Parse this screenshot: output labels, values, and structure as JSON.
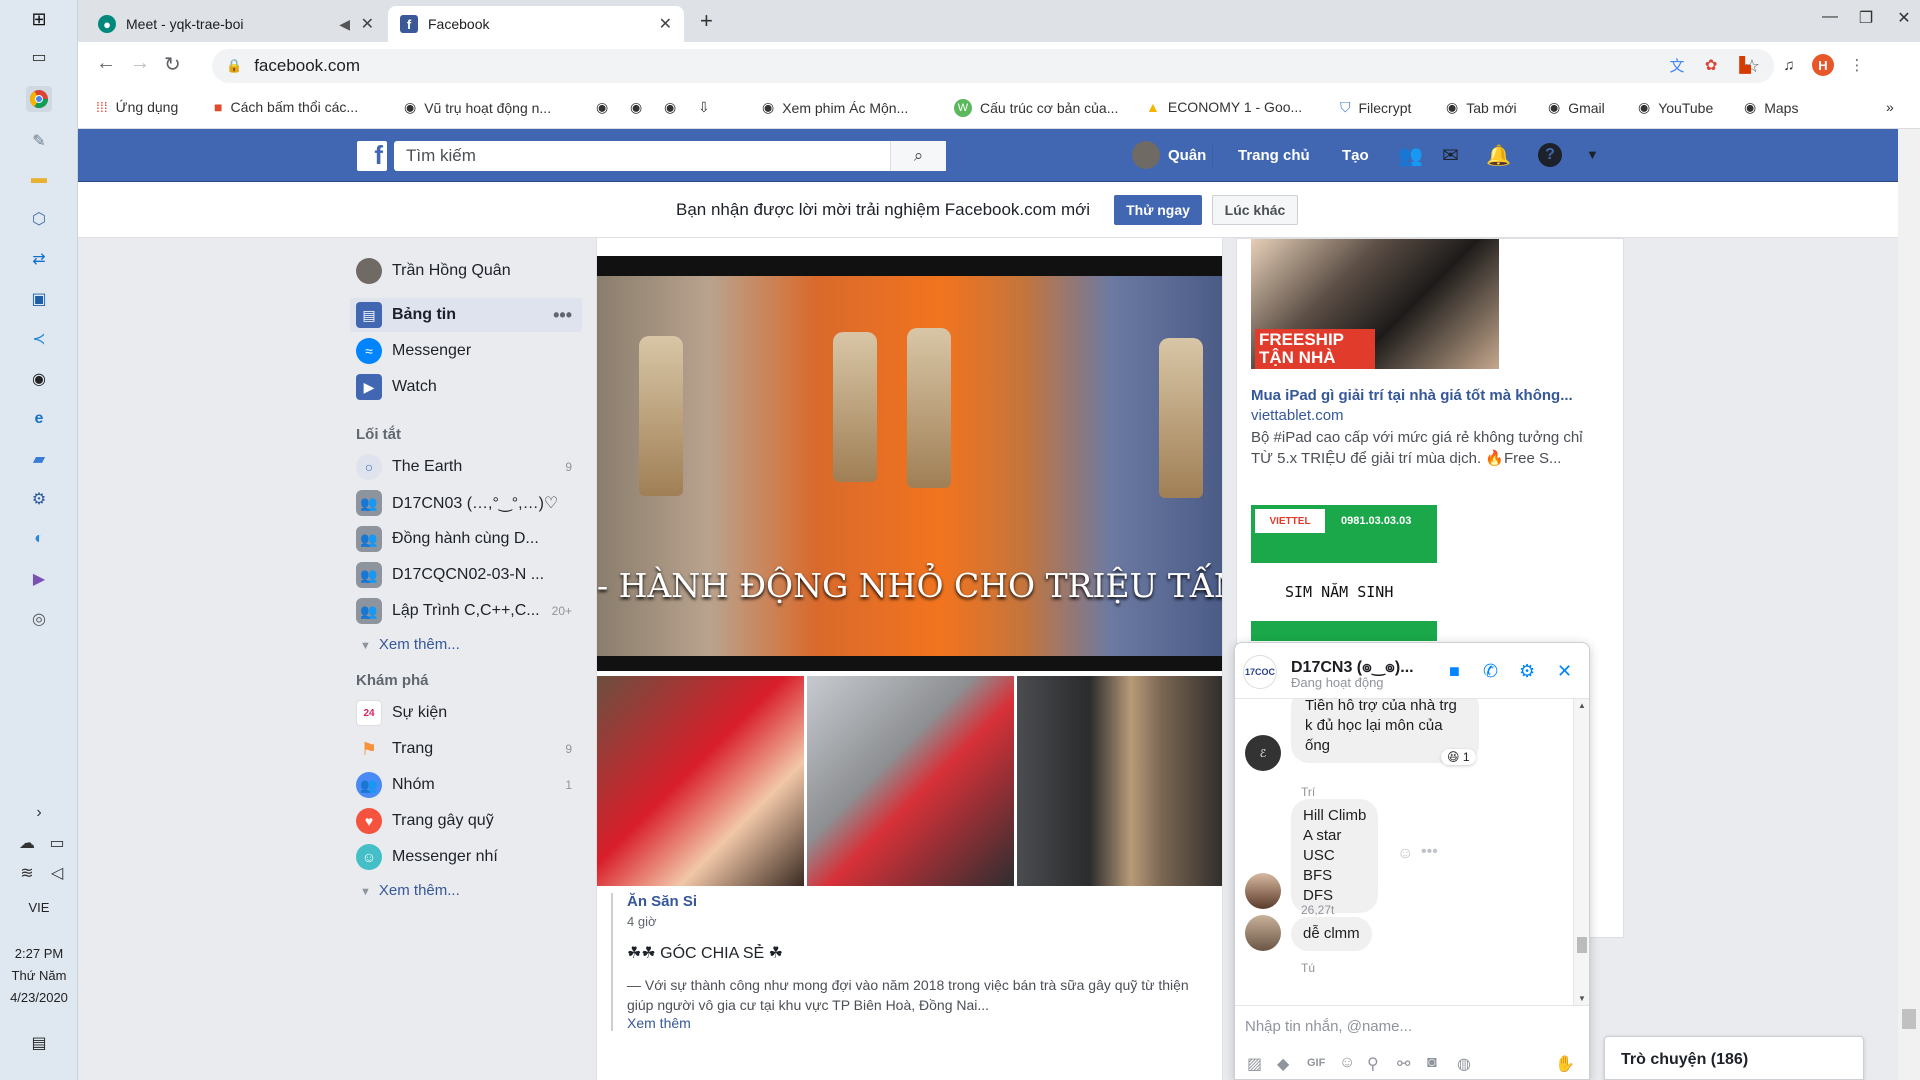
{
  "taskbar": {
    "language": "VIE",
    "time": "2:27 PM",
    "day": "Thứ Năm",
    "date": "4/23/2020"
  },
  "browser": {
    "tabs": [
      {
        "title": "Meet - yqk-trae-boi",
        "active": false
      },
      {
        "title": "Facebook",
        "active": true
      }
    ],
    "url": "facebook.com",
    "profile_initial": "H",
    "bookmarks": [
      {
        "label": "Ứng dụng",
        "icon": "apps-icon"
      },
      {
        "label": "Cách bấm thổi các...",
        "icon": "bookmark-icon"
      },
      {
        "label": "Vũ trụ hoạt động n...",
        "icon": "globe-icon"
      },
      {
        "label": "Xem phim Ác Mộn...",
        "icon": "globe-icon"
      },
      {
        "label": "Cấu trúc cơ bản của...",
        "icon": "w-icon"
      },
      {
        "label": "ECONOMY 1 - Goo...",
        "icon": "drive-icon"
      },
      {
        "label": "Filecrypt",
        "icon": "shield-icon"
      },
      {
        "label": "Tab mới",
        "icon": "globe-icon"
      },
      {
        "label": "Gmail",
        "icon": "globe-icon"
      },
      {
        "label": "YouTube",
        "icon": "globe-icon"
      },
      {
        "label": "Maps",
        "icon": "globe-icon"
      }
    ]
  },
  "facebook": {
    "search_placeholder": "Tìm kiếm",
    "nav": {
      "profile": "Quân",
      "home": "Trang chủ",
      "create": "Tạo"
    },
    "notice": {
      "text": "Bạn nhận được lời mời trải nghiệm Facebook.com mới",
      "try_label": "Thử ngay",
      "later_label": "Lúc khác"
    },
    "leftnav": {
      "profile": "Trần Hồng Quân",
      "main": [
        {
          "label": "Bảng tin",
          "icon": "news-feed-icon"
        },
        {
          "label": "Messenger",
          "icon": "messenger-icon"
        },
        {
          "label": "Watch",
          "icon": "watch-icon"
        }
      ],
      "shortcuts_title": "Lối tắt",
      "shortcuts": [
        {
          "label": "The Earth",
          "count": "9"
        },
        {
          "label": "D17CN03 (…,°‿°,…)♡",
          "count": ""
        },
        {
          "label": "Đồng hành cùng D...",
          "count": ""
        },
        {
          "label": "D17CQCN02-03-N ...",
          "count": ""
        },
        {
          "label": "Lập Trình C,C++,C...",
          "count": "20+"
        }
      ],
      "see_more": "Xem thêm...",
      "explore_title": "Khám phá",
      "explore": [
        {
          "label": "Sự kiện",
          "count": ""
        },
        {
          "label": "Trang",
          "count": "9"
        },
        {
          "label": "Nhóm",
          "count": "1"
        },
        {
          "label": "Trang gây quỹ",
          "count": ""
        },
        {
          "label": "Messenger nhí",
          "count": ""
        }
      ]
    },
    "post": {
      "overlay_text": "- HÀNH ĐỘNG NHỎ CHO TRIỆU TẤM",
      "author": "Ăn Săn Si",
      "time": "4 giờ",
      "title": "☘☘ GÓC CHIA SẺ ☘",
      "body": "— Với sự thành công như mong đợi vào năm 2018 trong việc bán trà sữa gây quỹ từ thiện giúp người vô gia cư tại khu vực TP Biên Hoà, Đồng Nai...",
      "see_more": "Xem thêm"
    },
    "ads": [
      {
        "image_text": "FREESHIP TẬN NHÀ",
        "title": "Mua iPad gì giải trí tại nhà giá tốt mà không...",
        "link": "viettablet.com",
        "desc": "Bộ #iPad cao cấp với mức giá rẻ không tưởng chỉ TỪ 5.x TRIỆU để giải trí mùa dịch. 🔥Free S..."
      },
      {
        "brand": "VIETTEL",
        "phone": "0981.03.03.03",
        "text": "SIM NĂM SINH"
      }
    ],
    "chat": {
      "name": "D17CN3 (๏‿๏)...",
      "status": "Đang hoạt động",
      "avatar_text": "17COC",
      "messages": [
        {
          "text": "Tiền hỗ trợ của nhà trg k đủ học lại môn của ống",
          "reaction": "😆 1"
        },
        {
          "sender": "Trí",
          "text": "Hill Climb\nA star\nUSC\nBFS\nDFS"
        },
        {
          "sender": "26,27t",
          "text": "dễ clmm"
        },
        {
          "sender": "Tú",
          "text": ""
        }
      ],
      "input_placeholder": "Nhập tin nhắn, @name..."
    },
    "chatbar_label": "Trò chuyện (186)"
  }
}
